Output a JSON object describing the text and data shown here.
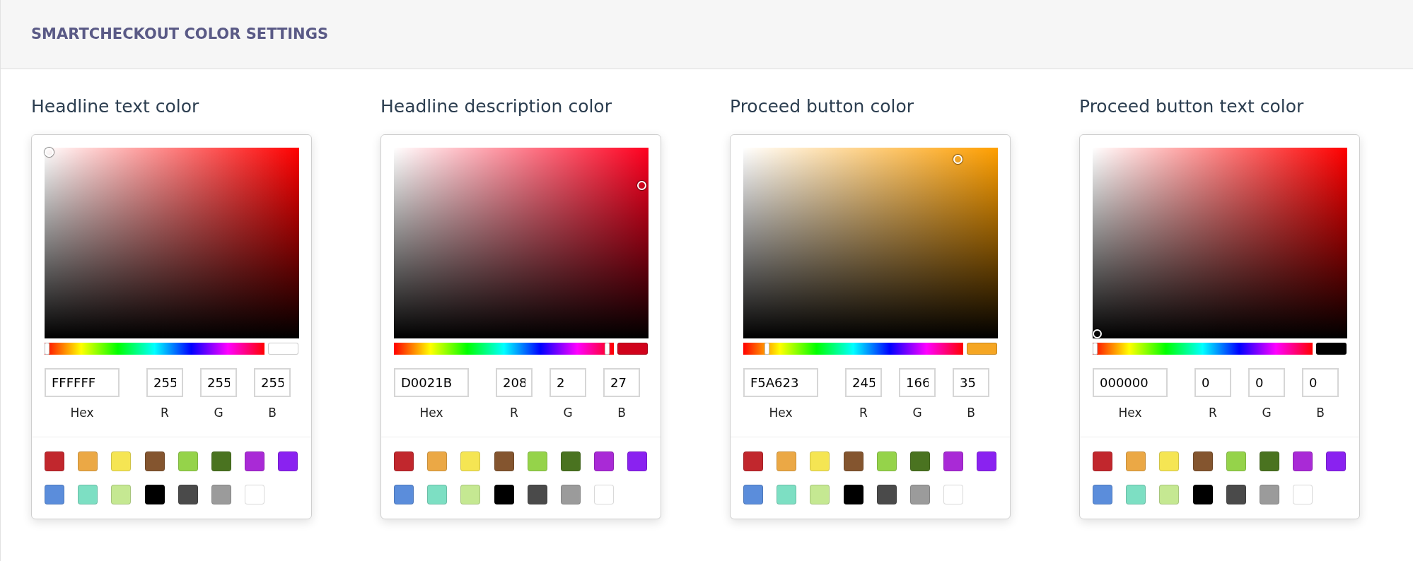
{
  "header": {
    "title": "SMARTCHECKOUT COLOR SETTINGS"
  },
  "pickers": [
    {
      "label": "Headline text color",
      "hue": {
        "level": 0
      },
      "fields": [
        {
          "kind": "hex",
          "label": "Hex",
          "value": "FFFFFF"
        },
        {
          "kind": "channel",
          "label": "R",
          "value": "255"
        },
        {
          "kind": "channel",
          "label": "G",
          "value": "255"
        },
        {
          "kind": "channel",
          "label": "B",
          "value": "255"
        }
      ],
      "swatches": [
        {
          "color": "#c1272d"
        },
        {
          "color": "#eba845"
        },
        {
          "color": "#f5e553"
        },
        {
          "color": "#84552f"
        },
        {
          "color": "#95d34a"
        },
        {
          "color": "#4a7320"
        },
        {
          "color": "#a92ad6"
        },
        {
          "color": "#8a22f0"
        },
        {
          "color": "#5b8ddb"
        },
        {
          "color": "#7ddfc3"
        },
        {
          "color": "#c5e892"
        },
        {
          "color": "#000000"
        },
        {
          "color": "#4a4a4a"
        },
        {
          "color": "#9b9b9b"
        },
        {
          "color": "#ffffff"
        }
      ]
    },
    {
      "label": "Headline description color",
      "hue": {
        "level": 0.98
      },
      "fields": [
        {
          "kind": "hex",
          "label": "Hex",
          "value": "D0021B"
        },
        {
          "kind": "channel",
          "label": "R",
          "value": "208"
        },
        {
          "kind": "channel",
          "label": "G",
          "value": "2"
        },
        {
          "kind": "channel",
          "label": "B",
          "value": "27"
        }
      ],
      "swatches": [
        {
          "color": "#c1272d"
        },
        {
          "color": "#eba845"
        },
        {
          "color": "#f5e553"
        },
        {
          "color": "#84552f"
        },
        {
          "color": "#95d34a"
        },
        {
          "color": "#4a7320"
        },
        {
          "color": "#a92ad6"
        },
        {
          "color": "#8a22f0"
        },
        {
          "color": "#5b8ddb"
        },
        {
          "color": "#7ddfc3"
        },
        {
          "color": "#c5e892"
        },
        {
          "color": "#000000"
        },
        {
          "color": "#4a4a4a"
        },
        {
          "color": "#9b9b9b"
        },
        {
          "color": "#ffffff"
        }
      ]
    },
    {
      "label": "Proceed button color",
      "hue": {
        "level": 0.1
      },
      "fields": [
        {
          "kind": "hex",
          "label": "Hex",
          "value": "F5A623"
        },
        {
          "kind": "channel",
          "label": "R",
          "value": "245"
        },
        {
          "kind": "channel",
          "label": "G",
          "value": "166"
        },
        {
          "kind": "channel",
          "label": "B",
          "value": "35"
        }
      ],
      "swatches": [
        {
          "color": "#c1272d"
        },
        {
          "color": "#eba845"
        },
        {
          "color": "#f5e553"
        },
        {
          "color": "#84552f"
        },
        {
          "color": "#95d34a"
        },
        {
          "color": "#4a7320"
        },
        {
          "color": "#a92ad6"
        },
        {
          "color": "#8a22f0"
        },
        {
          "color": "#5b8ddb"
        },
        {
          "color": "#7ddfc3"
        },
        {
          "color": "#c5e892"
        },
        {
          "color": "#000000"
        },
        {
          "color": "#4a4a4a"
        },
        {
          "color": "#9b9b9b"
        },
        {
          "color": "#ffffff"
        }
      ]
    },
    {
      "label": "Proceed button text color",
      "hue": {
        "level": 0
      },
      "fields": [
        {
          "kind": "hex",
          "label": "Hex",
          "value": "000000"
        },
        {
          "kind": "channel",
          "label": "R",
          "value": "0"
        },
        {
          "kind": "channel",
          "label": "G",
          "value": "0"
        },
        {
          "kind": "channel",
          "label": "B",
          "value": "0"
        }
      ],
      "swatches": [
        {
          "color": "#c1272d"
        },
        {
          "color": "#eba845"
        },
        {
          "color": "#f5e553"
        },
        {
          "color": "#84552f"
        },
        {
          "color": "#95d34a"
        },
        {
          "color": "#4a7320"
        },
        {
          "color": "#a92ad6"
        },
        {
          "color": "#8a22f0"
        },
        {
          "color": "#5b8ddb"
        },
        {
          "color": "#7ddfc3"
        },
        {
          "color": "#c5e892"
        },
        {
          "color": "#000000"
        },
        {
          "color": "#4a4a4a"
        },
        {
          "color": "#9b9b9b"
        },
        {
          "color": "#ffffff"
        }
      ]
    }
  ]
}
